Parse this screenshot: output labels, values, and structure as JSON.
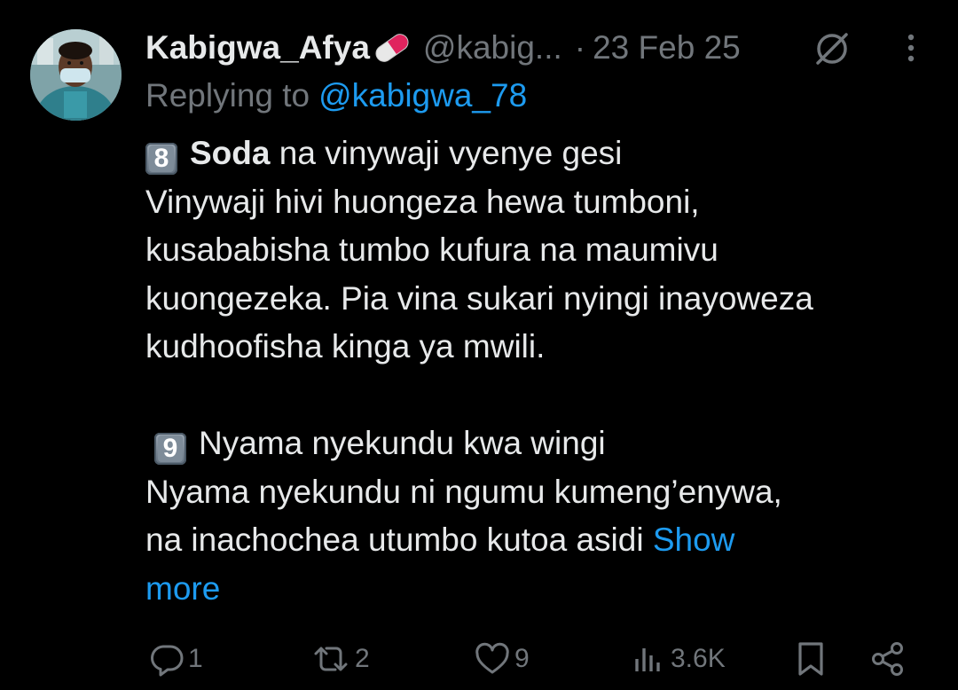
{
  "post": {
    "author_name": "Kabigwa_Afya",
    "author_emoji": "pill-icon",
    "handle": "@kabig...",
    "separator": "·",
    "date": "23 Feb 25",
    "replying_prefix": "Replying to",
    "replying_handle": "@kabigwa_78",
    "body": {
      "item8_number": "8",
      "item8_bold": "Soda",
      "item8_title_rest": " na vinywaji vyenye gesi",
      "item8_line1": "Vinywaji hivi huongeza hewa tumboni,",
      "item8_line2": "kusababisha tumbo kufura na maumivu",
      "item8_line3": "kuongezeka. Pia vina sukari nyingi inayoweza",
      "item8_line4": "kudhoofisha kinga ya mwili.",
      "item9_number": "9",
      "item9_title": "Nyama nyekundu kwa wingi",
      "item9_line1": "Nyama nyekundu ni ngumu kumeng’enywa,",
      "item9_line2": "na inachochea utumbo kutoa asidi",
      "show_more_part1": "Show",
      "show_more_part2": "more"
    }
  },
  "actions": {
    "replies": "1",
    "reposts": "2",
    "likes": "9",
    "views": "3.6K"
  },
  "colors": {
    "background": "#000000",
    "text": "#e7e9ea",
    "muted": "#71767b",
    "link": "#1d9bf0"
  },
  "icons": {
    "avatar": "avatar-photo",
    "grok": "grok-icon",
    "more": "more-dots-icon",
    "reply": "reply-icon",
    "repost": "repost-icon",
    "like": "heart-icon",
    "views": "views-icon",
    "bookmark": "bookmark-icon",
    "share": "share-icon"
  }
}
